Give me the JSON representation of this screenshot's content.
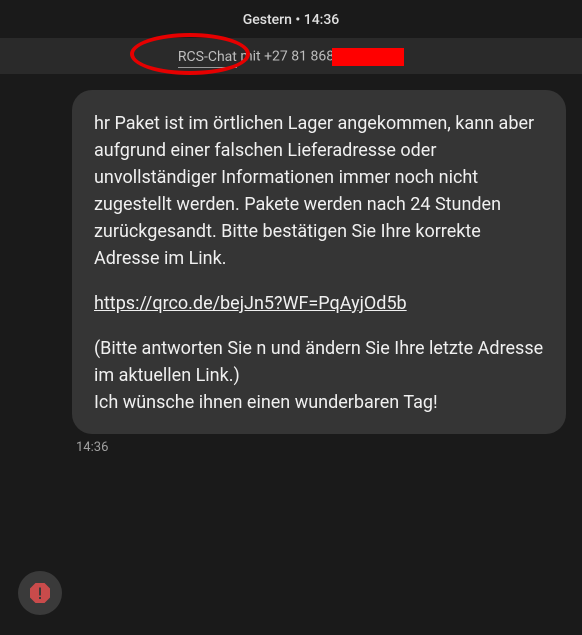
{
  "header": {
    "date_time": "Gestern • 14:36"
  },
  "chat_info": {
    "prefix": "RCS-Chat",
    "mid": " mit ",
    "phone": "+27 81 868"
  },
  "message": {
    "para1": "hr Paket ist im örtlichen Lager angekommen, kann aber aufgrund einer falschen Lieferadresse oder unvollständiger Informationen immer noch nicht zugestellt werden. Pakete werden nach 24 Stunden zurückgesandt. Bitte bestätigen Sie Ihre korrekte Adresse im Link.",
    "link": "https://qrco.de/bejJn5?WF=PqAyjOd5b",
    "para2_a": "(Bitte antworten Sie n und ändern Sie Ihre letzte Adresse im aktuellen Link.)",
    "para2_b": "Ich wünsche ihnen einen wunderbaren Tag!",
    "time": "14:36"
  }
}
